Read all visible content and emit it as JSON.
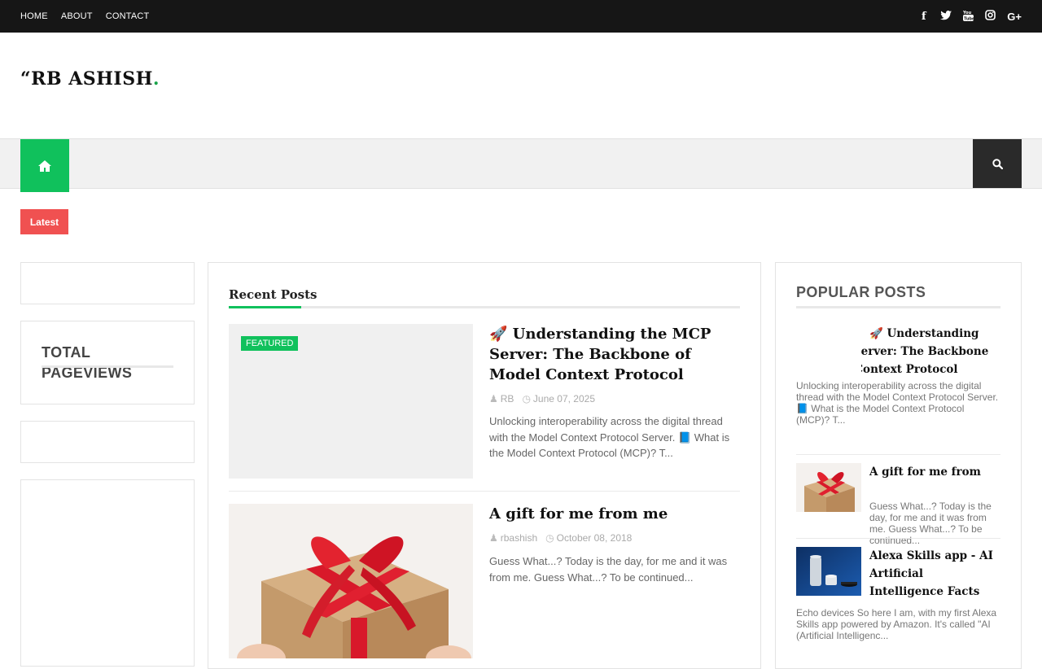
{
  "topbar": {
    "nav": [
      "HOME",
      "ABOUT",
      "CONTACT"
    ],
    "social_icons": [
      "facebook-icon",
      "twitter-icon",
      "youtube-icon",
      "instagram-icon",
      "google-plus-icon"
    ]
  },
  "logo": {
    "text": "“RB ASHISH",
    "dot": "."
  },
  "mainnav": {
    "home_icon": "home-icon",
    "search_icon": "search-icon"
  },
  "ticker": {
    "label": "Latest"
  },
  "left_sidebar": {
    "pageviews_title": "TOTAL PAGEVIEWS"
  },
  "recent": {
    "title": "Recent Posts",
    "posts": [
      {
        "badge": "FEATURED",
        "title": "🚀 Understanding the MCP Server: The Backbone of Model Context Protocol",
        "author": "RB",
        "date": "June 07, 2025",
        "excerpt": "Unlocking interoperability across the digital thread with the Model Context Protocol Server. 📘 What is the Model Context Protocol (MCP)? T..."
      },
      {
        "title": "A gift for me from me",
        "author": "rbashish",
        "date": "October 08, 2018",
        "excerpt": "Guess What...? Today is the day, for me and it was from me. Guess What...? To be continued..."
      }
    ]
  },
  "popular": {
    "title": "POPULAR POSTS",
    "items": [
      {
        "title": "🚀 Understanding the MCP Server: The Backbone of Model Context Protocol",
        "excerpt": "Unlocking interoperability across the digital thread with the Model Context Protocol Server. 📘 What is the Model Context Protocol (MCP)? T..."
      },
      {
        "title": "A gift for me from me",
        "excerpt": "Guess What...? Today is the day, for me and it was from me. Guess What...? To be continued..."
      },
      {
        "title": "Alexa Skills app - AI Artificial Intelligence Facts",
        "excerpt": "Echo devices  So here I am, with my first Alexa Skills app powered by Amazon. It's called   \"AI (Artificial Intelligenc..."
      }
    ]
  },
  "colors": {
    "accent": "#10c15c",
    "latest": "#f05151",
    "topbar": "#161616"
  }
}
